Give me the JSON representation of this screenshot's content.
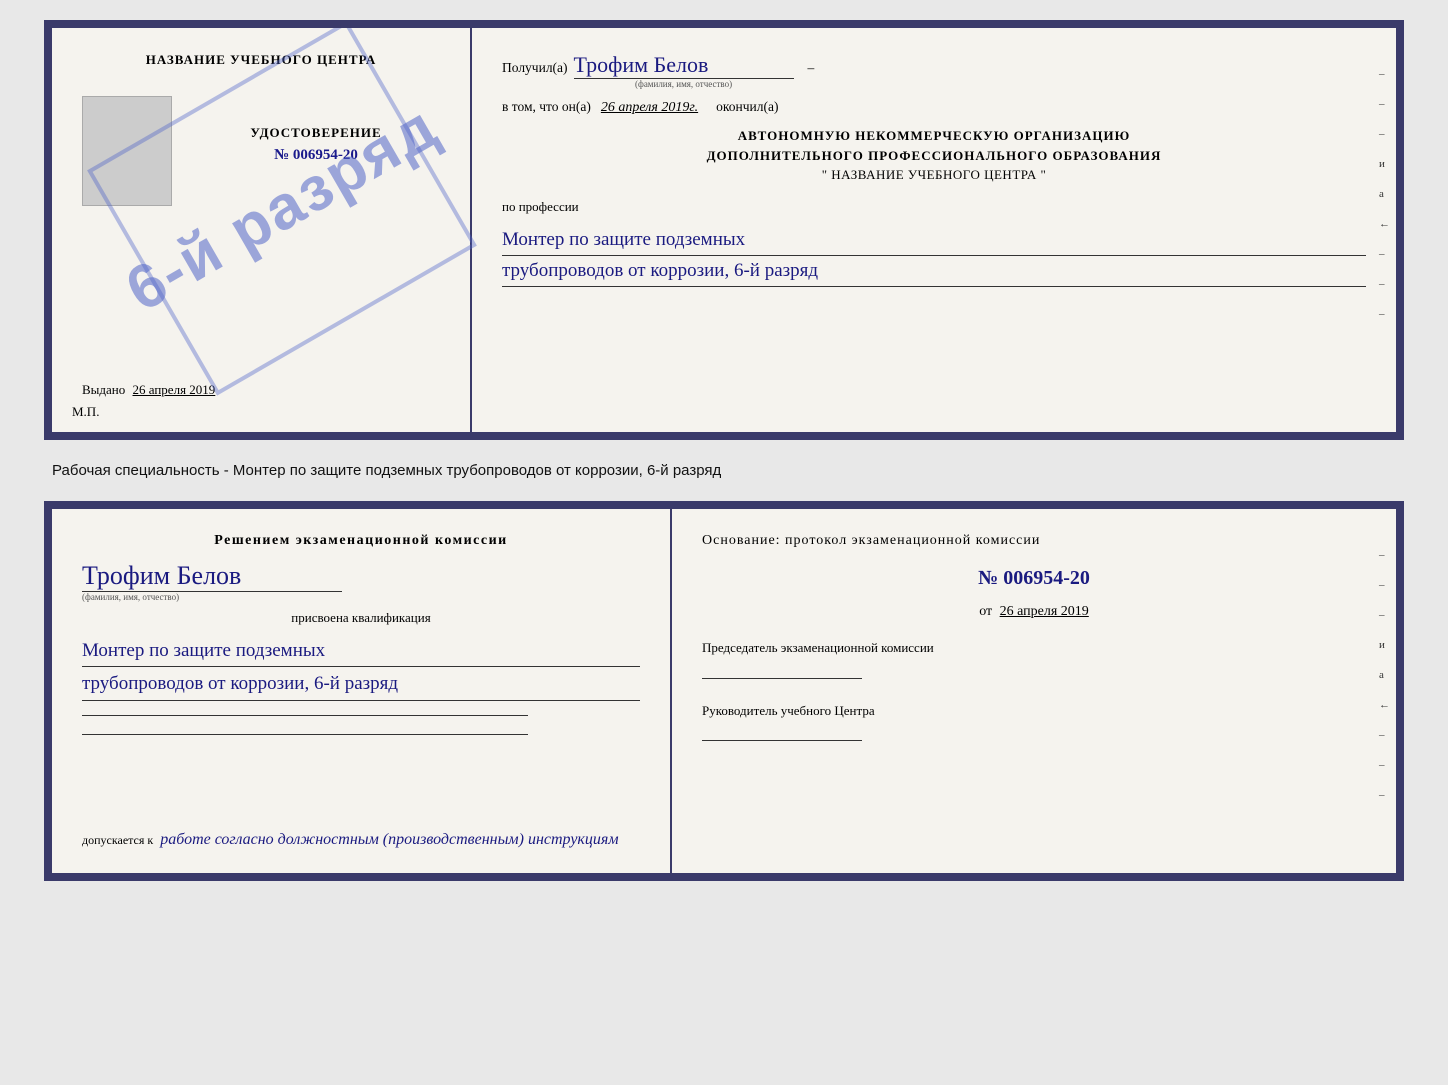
{
  "top_cert": {
    "left": {
      "center_title": "НАЗВАНИЕ УЧЕБНОГО ЦЕНТРА",
      "stamp_text": "6-й разряд",
      "udost_label": "УДОСТОВЕРЕНИЕ",
      "udost_number": "№ 006954-20",
      "vydano_label": "Выдано",
      "vydano_date": "26 апреля 2019",
      "mp": "М.П."
    },
    "right": {
      "poluchil_label": "Получил(a)",
      "poluchil_value": "Трофим Белов",
      "poluchil_subtext": "(фамилия, имя, отчество)",
      "vtom_label": "в том, что он(а)",
      "vtom_date": "26 апреля 2019г.",
      "okonchil_label": "окончил(а)",
      "org_line1": "АВТОНОМНУЮ НЕКОММЕРЧЕСКУЮ ОРГАНИЗАЦИЮ",
      "org_line2": "ДОПОЛНИТЕЛЬНОГО ПРОФЕССИОНАЛЬНОГО ОБРАЗОВАНИЯ",
      "org_line3": "\"  НАЗВАНИЕ УЧЕБНОГО ЦЕНТРА  \"",
      "po_professii": "по профессии",
      "profession_line1": "Монтер по защите подземных",
      "profession_line2": "трубопроводов от коррозии, 6-й разряд"
    }
  },
  "middle_text": "Рабочая специальность - Монтер по защите подземных трубопроводов от коррозии, 6-й разряд",
  "bottom_cert": {
    "left": {
      "decision_title": "Решением экзаменационной комиссии",
      "name_value": "Трофим Белов",
      "name_subtext": "(фамилия, имя, отчество)",
      "qualification_label": "присвоена квалификация",
      "qualification_line1": "Монтер по защите подземных",
      "qualification_line2": "трубопроводов от коррозии, 6-й разряд",
      "dopusk_prefix": "допускается к",
      "dopusk_value": "работе согласно должностным (производственным) инструкциям"
    },
    "right": {
      "basis_title": "Основание: протокол экзаменационной комиссии",
      "protocol_number": "№  006954-20",
      "from_prefix": "от",
      "from_date": "26 апреля 2019",
      "chairman_label": "Председатель экзаменационной комиссии",
      "head_label": "Руководитель учебного Центра"
    }
  },
  "side_marks": [
    "–",
    "–",
    "и",
    "а",
    "←",
    "–",
    "–",
    "–"
  ]
}
